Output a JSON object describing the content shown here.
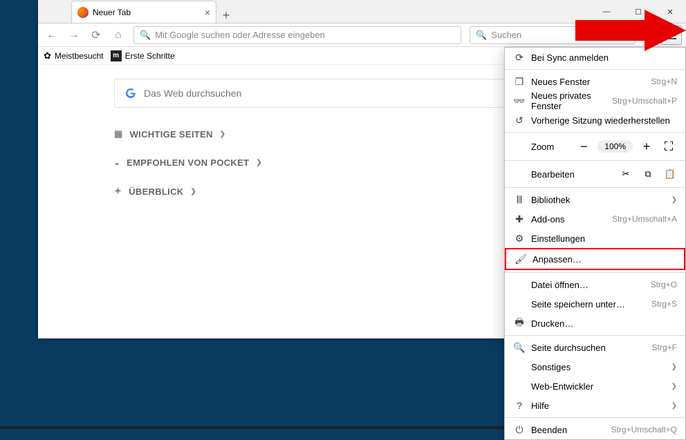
{
  "tab": {
    "title": "Neuer Tab"
  },
  "addressbar": {
    "placeholder": "Mit Google suchen oder Adresse eingeben"
  },
  "searchbar": {
    "placeholder": "Suchen"
  },
  "bookmarks": {
    "most_visited": "Meistbesucht",
    "getting_started": "Erste Schritte"
  },
  "content": {
    "search_placeholder": "Das Web durchsuchen",
    "top_sites": "WICHTIGE SEITEN",
    "pocket": "EMPFOHLEN VON POCKET",
    "highlights": "ÜBERBLICK"
  },
  "menu": {
    "sync": "Bei Sync anmelden",
    "new_window": {
      "label": "Neues Fenster",
      "shortcut": "Strg+N"
    },
    "private_window": {
      "label": "Neues privates Fenster",
      "shortcut": "Strg+Umschalt+P"
    },
    "restore": "Vorherige Sitzung wiederherstellen",
    "zoom": {
      "label": "Zoom",
      "value": "100%"
    },
    "edit": "Bearbeiten",
    "library": "Bibliothek",
    "addons": {
      "label": "Add-ons",
      "shortcut": "Strg+Umschalt+A"
    },
    "settings": "Einstellungen",
    "customize": "Anpassen…",
    "open_file": {
      "label": "Datei öffnen…",
      "shortcut": "Strg+O"
    },
    "save_page": {
      "label": "Seite speichern unter…",
      "shortcut": "Strg+S"
    },
    "print": "Drucken…",
    "find": {
      "label": "Seite durchsuchen",
      "shortcut": "Strg+F"
    },
    "more": "Sonstiges",
    "devtools": "Web-Entwickler",
    "help": "Hilfe",
    "quit": {
      "label": "Beenden",
      "shortcut": "Strg+Umschalt+Q"
    }
  }
}
